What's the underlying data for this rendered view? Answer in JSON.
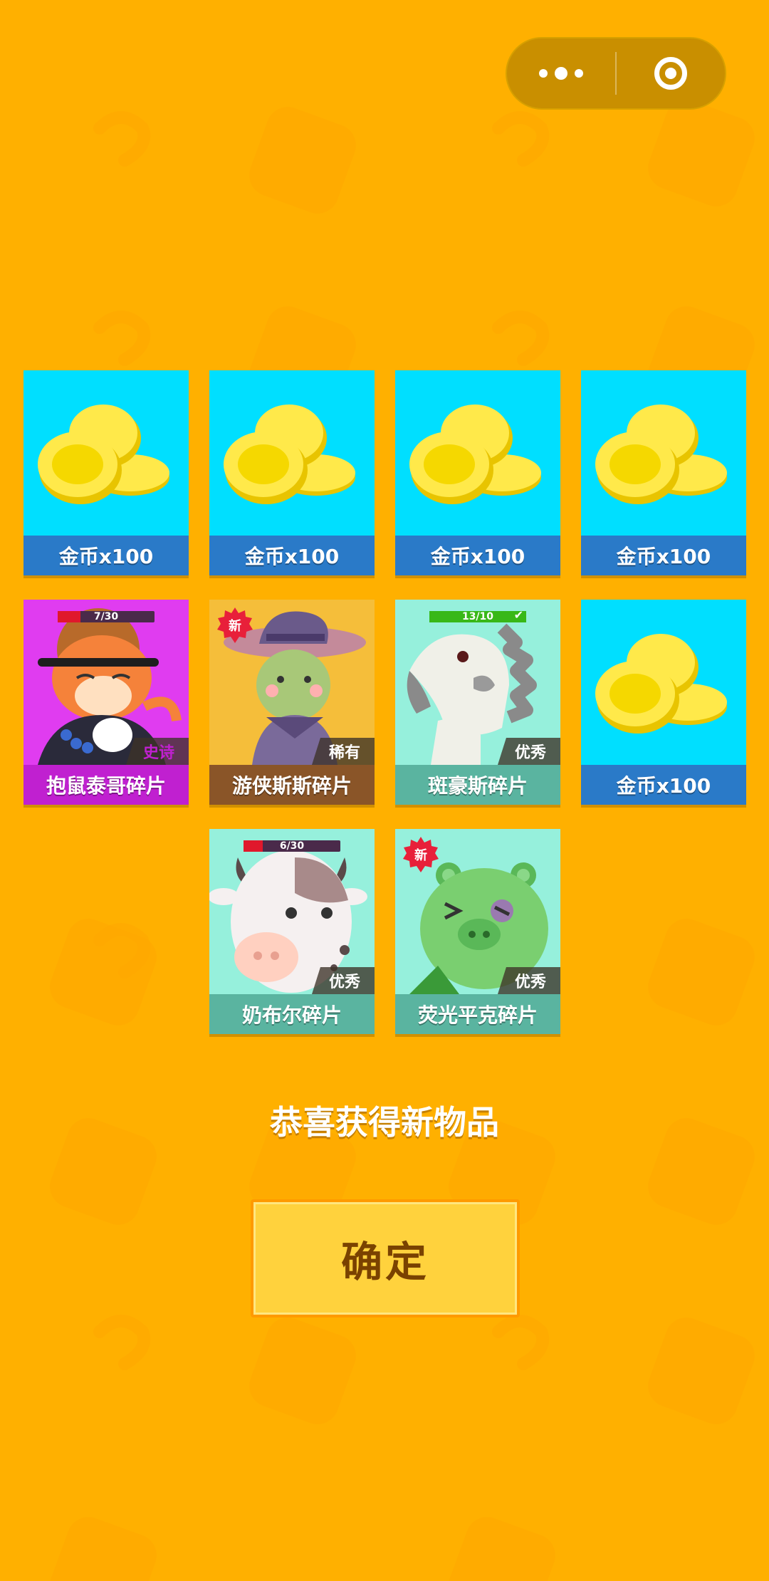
{
  "menu_capsule": {
    "more_icon": "more-dots-icon",
    "close_icon": "target-close-icon"
  },
  "cards": [
    {
      "label": "金币x100",
      "type": "coin"
    },
    {
      "label": "金币x100",
      "type": "coin"
    },
    {
      "label": "金币x100",
      "type": "coin"
    },
    {
      "label": "金币x100",
      "type": "coin"
    },
    {
      "label": "抱鼠泰哥碎片",
      "type": "character",
      "rarity": "史诗",
      "progress_text": "7/30",
      "progress_fraction": 0.233
    },
    {
      "label": "游侠斯斯碎片",
      "type": "character",
      "rarity": "稀有",
      "badge": "新"
    },
    {
      "label": "斑豪斯碎片",
      "type": "character",
      "rarity": "优秀",
      "progress_text": "13/10",
      "progress_fraction": 1.0
    },
    {
      "label": "金币x100",
      "type": "coin"
    },
    {
      "label": "奶布尔碎片",
      "type": "character",
      "rarity": "优秀",
      "progress_text": "6/30",
      "progress_fraction": 0.2
    },
    {
      "label": "荧光平克碎片",
      "type": "character",
      "rarity": "优秀",
      "badge": "新"
    }
  ],
  "congrats_text": "恭喜获得新物品",
  "confirm_label": "确定",
  "colors": {
    "background": "#FFB000",
    "coin_card_bg": "#00DFFF",
    "coin_label_bg": "#2A7AC8",
    "epic_bg": "#E03CF0",
    "epic_label_bg": "#C020D0",
    "rare_bg": "#F5BE3A",
    "rare_label_bg": "#8A5528",
    "good_bg": "#96F0DC",
    "good_label_bg": "#5AB4A0"
  }
}
